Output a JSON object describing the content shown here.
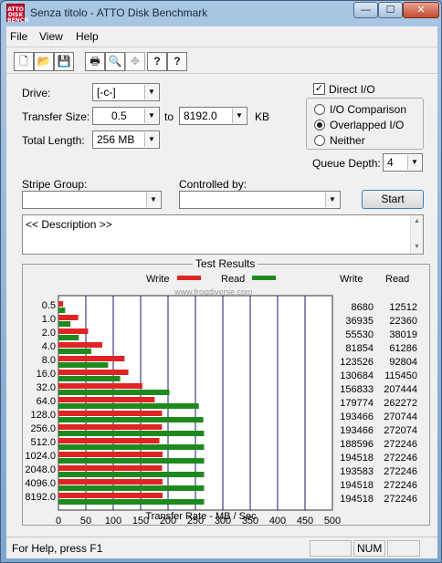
{
  "window": {
    "title": "Senza titolo - ATTO Disk Benchmark",
    "icon_text": "ATTO DISK BENCH",
    "minimize_glyph": "—",
    "maximize_glyph": "☐",
    "close_glyph": "✕"
  },
  "menu": [
    "File",
    "View",
    "Help"
  ],
  "toolbar": {
    "icons": [
      "new-file-icon",
      "open-folder-icon",
      "save-icon",
      "print-icon",
      "print-preview-icon",
      "move-icon",
      "help-icon",
      "context-help-icon"
    ],
    "glyphs": [
      "🗋",
      "📂",
      "💾",
      "🖶",
      "🔍",
      "✥",
      "?",
      "?"
    ]
  },
  "settings": {
    "drive_label": "Drive:",
    "drive_value": "[-c-]",
    "transfer_size_label": "Transfer Size:",
    "transfer_from": "0.5",
    "transfer_to_label": "to",
    "transfer_to": "8192.0",
    "transfer_unit": "KB",
    "total_length_label": "Total Length:",
    "total_length_value": "256 MB",
    "direct_io_label": "Direct I/O",
    "direct_io_checked": true,
    "io_options": [
      "I/O Comparison",
      "Overlapped I/O",
      "Neither"
    ],
    "io_selected": "Overlapped I/O",
    "queue_depth_label": "Queue Depth:",
    "queue_depth_value": "4",
    "stripe_group_label": "Stripe Group:",
    "controlled_by_label": "Controlled by:",
    "start_label": "Start",
    "description": "<< Description >>"
  },
  "results": {
    "title": "Test Results",
    "write_legend": "Write",
    "read_legend": "Read",
    "write_col": "Write",
    "read_col": "Read",
    "watermark": "www.frogdiverse.com"
  },
  "chart_data": {
    "type": "bar",
    "orientation": "horizontal",
    "categories": [
      "0.5",
      "1.0",
      "2.0",
      "4.0",
      "8.0",
      "16.0",
      "32.0",
      "64.0",
      "128.0",
      "256.0",
      "512.0",
      "1024.0",
      "2048.0",
      "4096.0",
      "8192.0"
    ],
    "series": [
      {
        "name": "Write",
        "color": "#e02424",
        "values": [
          8680,
          36935,
          55530,
          81854,
          123526,
          130684,
          156833,
          179774,
          193466,
          193466,
          188596,
          194518,
          193583,
          194518,
          194518
        ]
      },
      {
        "name": "Read",
        "color": "#1e8a1e",
        "values": [
          12512,
          22360,
          38019,
          61286,
          92804,
          115450,
          207444,
          262272,
          270744,
          272074,
          272246,
          272246,
          272246,
          272246,
          272246
        ]
      }
    ],
    "xlabel": "Transfer Rate - MB / Sec",
    "xticks": [
      0,
      50,
      100,
      150,
      200,
      250,
      300,
      350,
      400,
      450,
      500
    ],
    "xlim": [
      0,
      500
    ],
    "value_unit": "KB/s",
    "write_column": [
      "8680",
      "36935",
      "55530",
      "81854",
      "123526",
      "130684",
      "156833",
      "179774",
      "193466",
      "193466",
      "188596",
      "194518",
      "193583",
      "194518",
      "194518"
    ],
    "read_column": [
      "12512",
      "22360",
      "38019",
      "61286",
      "92804",
      "115450",
      "207444",
      "262272",
      "270744",
      "272074",
      "272246",
      "272246",
      "272246",
      "272246",
      "272246"
    ]
  },
  "status": {
    "help_text": "For Help, press F1",
    "num_indicator": "NUM"
  }
}
